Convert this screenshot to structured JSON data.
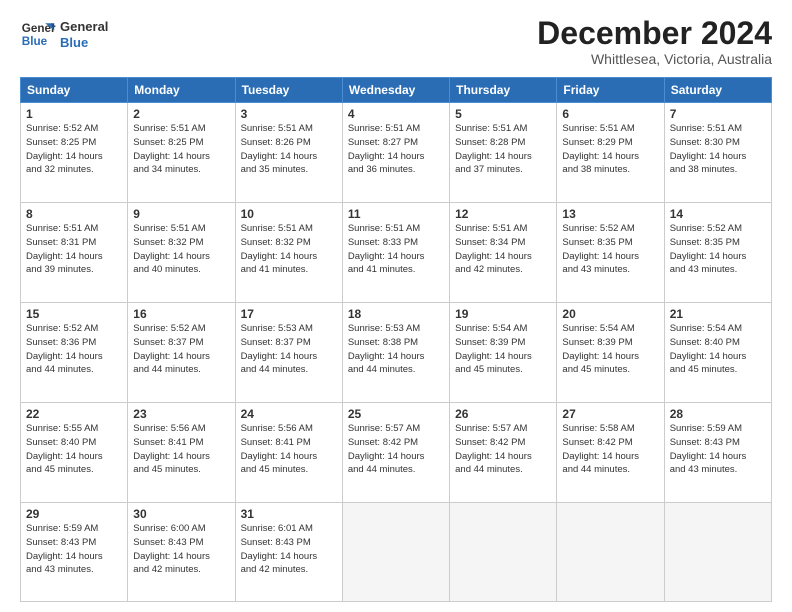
{
  "header": {
    "logo_line1": "General",
    "logo_line2": "Blue",
    "month": "December 2024",
    "location": "Whittlesea, Victoria, Australia"
  },
  "days_of_week": [
    "Sunday",
    "Monday",
    "Tuesday",
    "Wednesday",
    "Thursday",
    "Friday",
    "Saturday"
  ],
  "weeks": [
    [
      {
        "day": 1,
        "info": "Sunrise: 5:52 AM\nSunset: 8:25 PM\nDaylight: 14 hours\nand 32 minutes."
      },
      {
        "day": 2,
        "info": "Sunrise: 5:51 AM\nSunset: 8:25 PM\nDaylight: 14 hours\nand 34 minutes."
      },
      {
        "day": 3,
        "info": "Sunrise: 5:51 AM\nSunset: 8:26 PM\nDaylight: 14 hours\nand 35 minutes."
      },
      {
        "day": 4,
        "info": "Sunrise: 5:51 AM\nSunset: 8:27 PM\nDaylight: 14 hours\nand 36 minutes."
      },
      {
        "day": 5,
        "info": "Sunrise: 5:51 AM\nSunset: 8:28 PM\nDaylight: 14 hours\nand 37 minutes."
      },
      {
        "day": 6,
        "info": "Sunrise: 5:51 AM\nSunset: 8:29 PM\nDaylight: 14 hours\nand 38 minutes."
      },
      {
        "day": 7,
        "info": "Sunrise: 5:51 AM\nSunset: 8:30 PM\nDaylight: 14 hours\nand 38 minutes."
      }
    ],
    [
      {
        "day": 8,
        "info": "Sunrise: 5:51 AM\nSunset: 8:31 PM\nDaylight: 14 hours\nand 39 minutes."
      },
      {
        "day": 9,
        "info": "Sunrise: 5:51 AM\nSunset: 8:32 PM\nDaylight: 14 hours\nand 40 minutes."
      },
      {
        "day": 10,
        "info": "Sunrise: 5:51 AM\nSunset: 8:32 PM\nDaylight: 14 hours\nand 41 minutes."
      },
      {
        "day": 11,
        "info": "Sunrise: 5:51 AM\nSunset: 8:33 PM\nDaylight: 14 hours\nand 41 minutes."
      },
      {
        "day": 12,
        "info": "Sunrise: 5:51 AM\nSunset: 8:34 PM\nDaylight: 14 hours\nand 42 minutes."
      },
      {
        "day": 13,
        "info": "Sunrise: 5:52 AM\nSunset: 8:35 PM\nDaylight: 14 hours\nand 43 minutes."
      },
      {
        "day": 14,
        "info": "Sunrise: 5:52 AM\nSunset: 8:35 PM\nDaylight: 14 hours\nand 43 minutes."
      }
    ],
    [
      {
        "day": 15,
        "info": "Sunrise: 5:52 AM\nSunset: 8:36 PM\nDaylight: 14 hours\nand 44 minutes."
      },
      {
        "day": 16,
        "info": "Sunrise: 5:52 AM\nSunset: 8:37 PM\nDaylight: 14 hours\nand 44 minutes."
      },
      {
        "day": 17,
        "info": "Sunrise: 5:53 AM\nSunset: 8:37 PM\nDaylight: 14 hours\nand 44 minutes."
      },
      {
        "day": 18,
        "info": "Sunrise: 5:53 AM\nSunset: 8:38 PM\nDaylight: 14 hours\nand 44 minutes."
      },
      {
        "day": 19,
        "info": "Sunrise: 5:54 AM\nSunset: 8:39 PM\nDaylight: 14 hours\nand 45 minutes."
      },
      {
        "day": 20,
        "info": "Sunrise: 5:54 AM\nSunset: 8:39 PM\nDaylight: 14 hours\nand 45 minutes."
      },
      {
        "day": 21,
        "info": "Sunrise: 5:54 AM\nSunset: 8:40 PM\nDaylight: 14 hours\nand 45 minutes."
      }
    ],
    [
      {
        "day": 22,
        "info": "Sunrise: 5:55 AM\nSunset: 8:40 PM\nDaylight: 14 hours\nand 45 minutes."
      },
      {
        "day": 23,
        "info": "Sunrise: 5:56 AM\nSunset: 8:41 PM\nDaylight: 14 hours\nand 45 minutes."
      },
      {
        "day": 24,
        "info": "Sunrise: 5:56 AM\nSunset: 8:41 PM\nDaylight: 14 hours\nand 45 minutes."
      },
      {
        "day": 25,
        "info": "Sunrise: 5:57 AM\nSunset: 8:42 PM\nDaylight: 14 hours\nand 44 minutes."
      },
      {
        "day": 26,
        "info": "Sunrise: 5:57 AM\nSunset: 8:42 PM\nDaylight: 14 hours\nand 44 minutes."
      },
      {
        "day": 27,
        "info": "Sunrise: 5:58 AM\nSunset: 8:42 PM\nDaylight: 14 hours\nand 44 minutes."
      },
      {
        "day": 28,
        "info": "Sunrise: 5:59 AM\nSunset: 8:43 PM\nDaylight: 14 hours\nand 43 minutes."
      }
    ],
    [
      {
        "day": 29,
        "info": "Sunrise: 5:59 AM\nSunset: 8:43 PM\nDaylight: 14 hours\nand 43 minutes."
      },
      {
        "day": 30,
        "info": "Sunrise: 6:00 AM\nSunset: 8:43 PM\nDaylight: 14 hours\nand 42 minutes."
      },
      {
        "day": 31,
        "info": "Sunrise: 6:01 AM\nSunset: 8:43 PM\nDaylight: 14 hours\nand 42 minutes."
      },
      null,
      null,
      null,
      null
    ]
  ]
}
